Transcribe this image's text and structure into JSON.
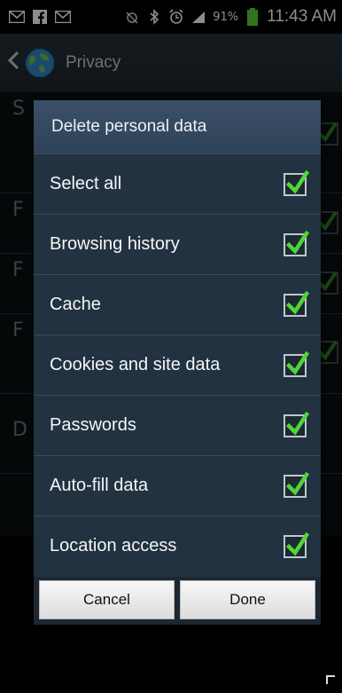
{
  "status_bar": {
    "battery_percent": "91%",
    "time": "11:43 AM"
  },
  "action_bar": {
    "title": "Privacy"
  },
  "dialog": {
    "title": "Delete personal data",
    "options": [
      {
        "label": "Select all",
        "checked": true
      },
      {
        "label": "Browsing history",
        "checked": true
      },
      {
        "label": "Cache",
        "checked": true
      },
      {
        "label": "Cookies and site data",
        "checked": true
      },
      {
        "label": "Passwords",
        "checked": true
      },
      {
        "label": "Auto-fill data",
        "checked": true
      },
      {
        "label": "Location access",
        "checked": true
      }
    ],
    "cancel_label": "Cancel",
    "done_label": "Done"
  },
  "background_list": {
    "row_initials": [
      "S",
      "F",
      "F",
      "F",
      "D"
    ]
  },
  "colors": {
    "check_green": "#4fd63a",
    "dialog_bg": "#223240",
    "dialog_title_bg": "#3b5068"
  }
}
